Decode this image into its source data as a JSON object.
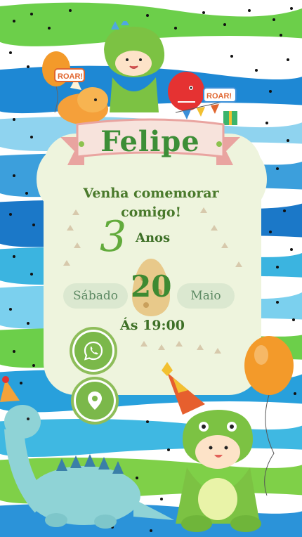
{
  "invitation": {
    "name": "Felipe",
    "message": "Venha comemorar comigo!",
    "age_number": "3",
    "age_label": "Anos",
    "weekday": "Sábado",
    "day": "20",
    "month": "Maio",
    "time": "Ás 19:00"
  },
  "decorations": {
    "roar_left": "ROAR!",
    "roar_right": "ROAR!"
  },
  "buttons": {
    "whatsapp_icon": "whatsapp-icon",
    "location_icon": "location-pin-icon"
  },
  "colors": {
    "accent_green": "#3d8e37",
    "button_green": "#7bb84a",
    "card_bg": "#eef4dd",
    "stripe_blue": "#2a8fd6",
    "stripe_green": "#7cd34a",
    "egg": "#e8c98a"
  }
}
